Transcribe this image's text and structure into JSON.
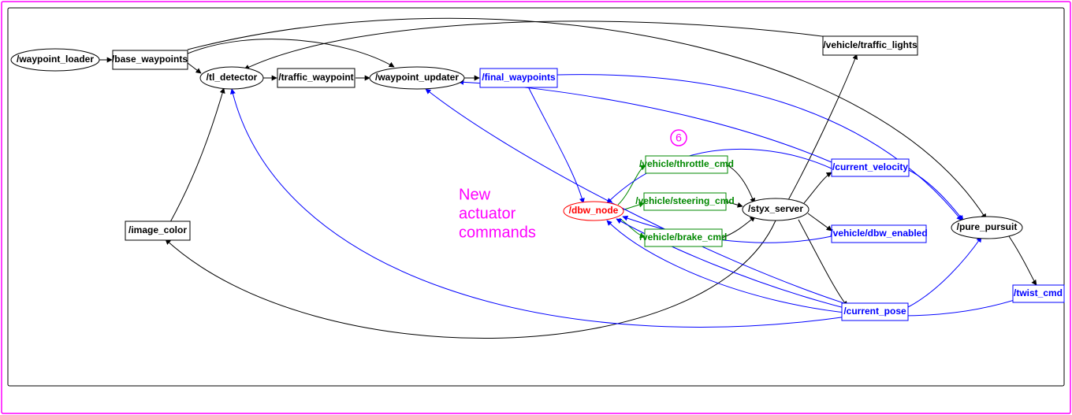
{
  "annotation": {
    "line1": "New",
    "line2": "actuator",
    "line3": "commands",
    "step": "6"
  },
  "nodes": {
    "waypoint_loader": {
      "label": "/waypoint_loader"
    },
    "base_waypoints": {
      "label": "/base_waypoints"
    },
    "tl_detector": {
      "label": "/tl_detector"
    },
    "traffic_waypoint": {
      "label": "/traffic_waypoint"
    },
    "waypoint_updater": {
      "label": "/waypoint_updater"
    },
    "final_waypoints": {
      "label": "/final_waypoints"
    },
    "image_color": {
      "label": "/image_color"
    },
    "dbw_node": {
      "label": "/dbw_node"
    },
    "vehicle_throttle_cmd": {
      "label": "/vehicle/throttle_cmd"
    },
    "vehicle_steering_cmd": {
      "label": "/vehicle/steering_cmd"
    },
    "vehicle_brake_cmd": {
      "label": "/vehicle/brake_cmd"
    },
    "styx_server": {
      "label": "/styx_server"
    },
    "current_velocity": {
      "label": "/current_velocity"
    },
    "vehicle_dbw_enabled": {
      "label": "/vehicle/dbw_enabled"
    },
    "current_pose": {
      "label": "/current_pose"
    },
    "vehicle_traffic_lights": {
      "label": "/vehicle/traffic_lights"
    },
    "pure_pursuit": {
      "label": "/pure_pursuit"
    },
    "twist_cmd": {
      "label": "/twist_cmd"
    }
  }
}
